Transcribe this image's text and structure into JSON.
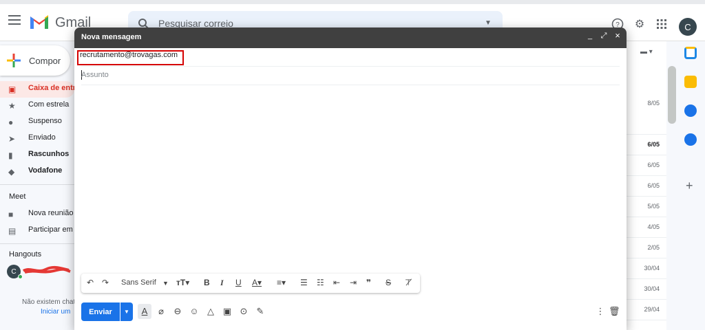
{
  "header": {
    "app_name": "Gmail",
    "search_placeholder": "Pesquisar correio",
    "avatar_initial": "C"
  },
  "nav": {
    "compose_label": "Compor",
    "items": [
      {
        "label": "Caixa de entr",
        "icon": "inbox-icon"
      },
      {
        "label": "Com estrela",
        "icon": "star-icon"
      },
      {
        "label": "Suspenso",
        "icon": "clock-icon"
      },
      {
        "label": "Enviado",
        "icon": "send-icon"
      },
      {
        "label": "Rascunhos",
        "icon": "draft-icon"
      },
      {
        "label": "Vodafone",
        "icon": "label-icon"
      }
    ],
    "meet_title": "Meet",
    "meet_items": [
      {
        "label": "Nova reunião",
        "icon": "video-icon"
      },
      {
        "label": "Participar em",
        "icon": "keyboard-icon"
      }
    ],
    "hangouts_title": "Hangouts",
    "hangouts_avatar": "C",
    "no_chats": "Não existem chat",
    "start_link": "Iniciar um"
  },
  "list": {
    "dates": [
      "8/05",
      "6/05",
      "6/05",
      "6/05",
      "5/05",
      "4/05",
      "2/05",
      "30/04",
      "30/04",
      "29/04"
    ]
  },
  "compose": {
    "title": "Nova mensagem",
    "minimize": "_",
    "expand": "⤢",
    "close": "×",
    "to_value": "recrutamento@trovagas.com",
    "subject_placeholder": "Assunto",
    "font_name": "Sans Serif",
    "send_label": "Enviar"
  },
  "colors": {
    "send_blue": "#1a73e8",
    "highlight_red": "#d50000",
    "header_dark": "#404040"
  }
}
